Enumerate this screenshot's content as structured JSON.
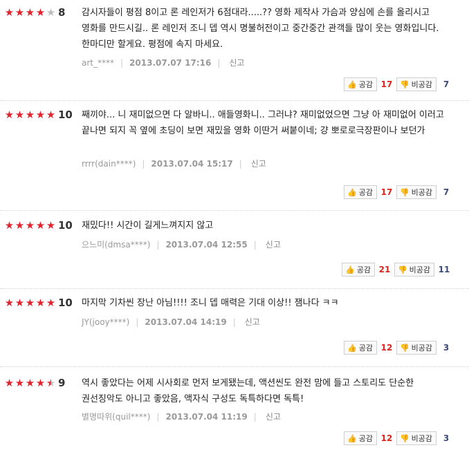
{
  "reviews": [
    {
      "stars": [
        "on",
        "on",
        "on",
        "on",
        "off"
      ],
      "score": "8",
      "text": "감시자들이 평점 8이고 론 레인저가 6점대라.....?? 영화 제작사 가슴과 양심에 손를 올리시고 영화를 만드시길.. 론 레인저 조니 뎁 역시 명불허전이고 중간중간 관객들 많이 웃는 영화입니다. 한마디만 할게요. 평점에 속지 마세요.",
      "user": "art_****",
      "date": "2013.07.07 17:16",
      "report": "신고",
      "like_label": "공감",
      "like_count": "17",
      "dislike_label": "비공감",
      "dislike_count": "7"
    },
    {
      "stars": [
        "on",
        "on",
        "on",
        "on",
        "on"
      ],
      "score": "10",
      "text": "째끼야... 니 재미없으면 다 알바니.. 애들영화니.. 그러냐? 재미없었으면 그냥 아 재미없어 이러고 끝나면 되지 꼭 옆에 초딩이 보면 재밌을 영화 이딴거 써붙이네; 걍 뽀로로극장판이나 보던가",
      "user": "rrrr(dain****)",
      "date": "2013.07.04 15:17",
      "report": "신고",
      "like_label": "공감",
      "like_count": "17",
      "dislike_label": "비공감",
      "dislike_count": "7"
    },
    {
      "stars": [
        "on",
        "on",
        "on",
        "on",
        "on"
      ],
      "score": "10",
      "text": "재밌다!! 시간이 길게느껴지지 않고",
      "user": "으느미(dmsa****)",
      "date": "2013.07.04 12:55",
      "report": "신고",
      "like_label": "공감",
      "like_count": "21",
      "dislike_label": "비공감",
      "dislike_count": "11"
    },
    {
      "stars": [
        "on",
        "on",
        "on",
        "on",
        "on"
      ],
      "score": "10",
      "text": "마지막 기차씬 장난 아님!!!! 조니 뎁 매력은 기대 이상!! 잼나다 ㅋㅋ",
      "user": "JY(jooy****)",
      "date": "2013.07.04 14:19",
      "report": "신고",
      "like_label": "공감",
      "like_count": "12",
      "dislike_label": "비공감",
      "dislike_count": "3"
    },
    {
      "stars": [
        "on",
        "on",
        "on",
        "on",
        "half"
      ],
      "score": "9",
      "text": "역시 좋았다는 어제 시사회로 먼저 보게됐는데, 액션씬도 완전 맘에 들고 스토리도 단순한 권선징악도 아니고 좋았음, 액자식 구성도 독특하다면 독특!",
      "user": "별명따위(quil****)",
      "date": "2013.07.04 11:19",
      "report": "신고",
      "like_label": "공감",
      "like_count": "12",
      "dislike_label": "비공감",
      "dislike_count": "3"
    }
  ]
}
